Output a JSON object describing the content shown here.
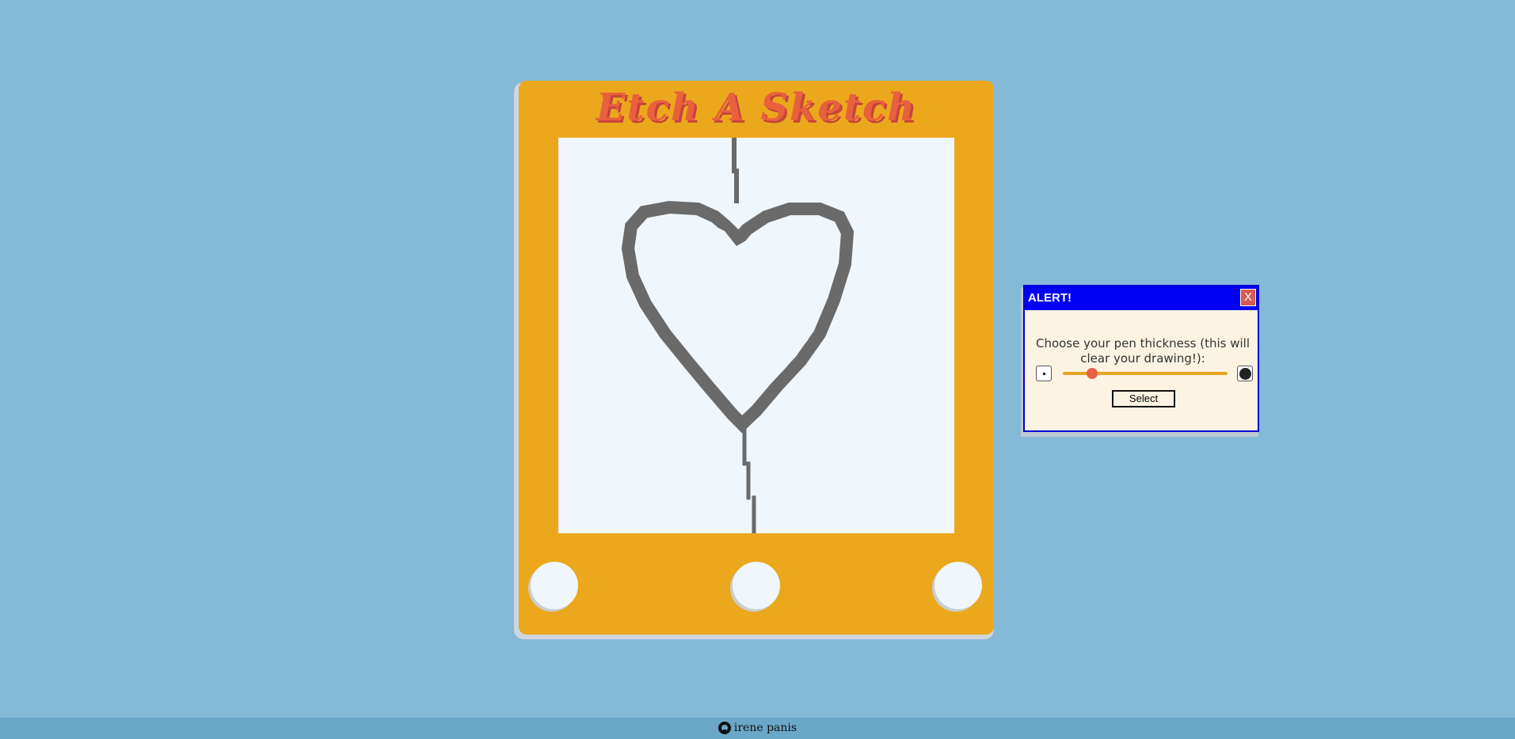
{
  "app": {
    "title": "Etch A Sketch"
  },
  "dialog": {
    "title": "ALERT!",
    "close_label": "X",
    "message_line1": "Choose your pen thickness (this will",
    "message_line2": "clear your drawing!):",
    "slider_value_fraction": 0.18,
    "small_thickness_icon": "small-dot-icon",
    "large_thickness_icon": "large-dot-icon",
    "select_label": "Select"
  },
  "footer": {
    "icon": "github-icon",
    "author": "irene panis"
  },
  "colors": {
    "background": "#85b9d8",
    "frame": "#eba81c",
    "title": "#e8603e",
    "canvas": "#eff6fc",
    "ink": "#6a6a6a",
    "dialog_header": "#0000f5",
    "dialog_body": "#fdf3e3",
    "slider_track": "#e6a625",
    "slider_thumb": "#ea6144",
    "footer": "#6aa7c9"
  }
}
